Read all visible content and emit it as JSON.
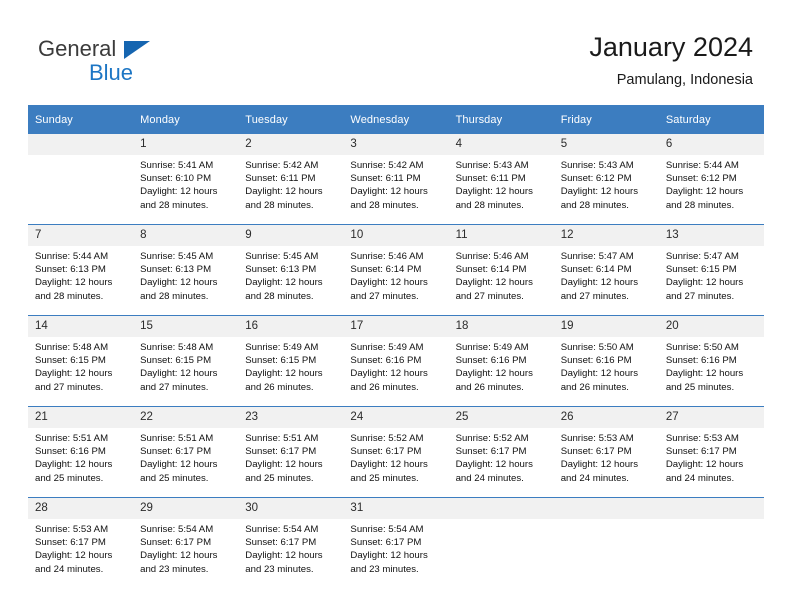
{
  "brand": {
    "name_part1": "General",
    "name_part2": "Blue",
    "triangle_icon": "blue-triangle-icon",
    "color_primary": "#1d76c4",
    "color_text": "#3b3b3b"
  },
  "header": {
    "title": "January 2024",
    "subtitle": "Pamulang, Indonesia"
  },
  "theme": {
    "header_row_bg": "#3c7dc0",
    "daynum_bg": "#f1f1f1",
    "divider": "#3c7dc0"
  },
  "weekdays": [
    "Sunday",
    "Monday",
    "Tuesday",
    "Wednesday",
    "Thursday",
    "Friday",
    "Saturday"
  ],
  "labels": {
    "sunrise_prefix": "Sunrise:",
    "sunset_prefix": "Sunset:",
    "daylight_prefix": "Daylight:"
  },
  "weeks": [
    [
      {
        "day": "",
        "blank": true,
        "l1": "",
        "l2": "",
        "l3": "",
        "l4": ""
      },
      {
        "day": "1",
        "l1": "Sunrise: 5:41 AM",
        "l2": "Sunset: 6:10 PM",
        "l3": "Daylight: 12 hours",
        "l4": "and 28 minutes."
      },
      {
        "day": "2",
        "l1": "Sunrise: 5:42 AM",
        "l2": "Sunset: 6:11 PM",
        "l3": "Daylight: 12 hours",
        "l4": "and 28 minutes."
      },
      {
        "day": "3",
        "l1": "Sunrise: 5:42 AM",
        "l2": "Sunset: 6:11 PM",
        "l3": "Daylight: 12 hours",
        "l4": "and 28 minutes."
      },
      {
        "day": "4",
        "l1": "Sunrise: 5:43 AM",
        "l2": "Sunset: 6:11 PM",
        "l3": "Daylight: 12 hours",
        "l4": "and 28 minutes."
      },
      {
        "day": "5",
        "l1": "Sunrise: 5:43 AM",
        "l2": "Sunset: 6:12 PM",
        "l3": "Daylight: 12 hours",
        "l4": "and 28 minutes."
      },
      {
        "day": "6",
        "l1": "Sunrise: 5:44 AM",
        "l2": "Sunset: 6:12 PM",
        "l3": "Daylight: 12 hours",
        "l4": "and 28 minutes."
      }
    ],
    [
      {
        "day": "7",
        "l1": "Sunrise: 5:44 AM",
        "l2": "Sunset: 6:13 PM",
        "l3": "Daylight: 12 hours",
        "l4": "and 28 minutes."
      },
      {
        "day": "8",
        "l1": "Sunrise: 5:45 AM",
        "l2": "Sunset: 6:13 PM",
        "l3": "Daylight: 12 hours",
        "l4": "and 28 minutes."
      },
      {
        "day": "9",
        "l1": "Sunrise: 5:45 AM",
        "l2": "Sunset: 6:13 PM",
        "l3": "Daylight: 12 hours",
        "l4": "and 28 minutes."
      },
      {
        "day": "10",
        "l1": "Sunrise: 5:46 AM",
        "l2": "Sunset: 6:14 PM",
        "l3": "Daylight: 12 hours",
        "l4": "and 27 minutes."
      },
      {
        "day": "11",
        "l1": "Sunrise: 5:46 AM",
        "l2": "Sunset: 6:14 PM",
        "l3": "Daylight: 12 hours",
        "l4": "and 27 minutes."
      },
      {
        "day": "12",
        "l1": "Sunrise: 5:47 AM",
        "l2": "Sunset: 6:14 PM",
        "l3": "Daylight: 12 hours",
        "l4": "and 27 minutes."
      },
      {
        "day": "13",
        "l1": "Sunrise: 5:47 AM",
        "l2": "Sunset: 6:15 PM",
        "l3": "Daylight: 12 hours",
        "l4": "and 27 minutes."
      }
    ],
    [
      {
        "day": "14",
        "l1": "Sunrise: 5:48 AM",
        "l2": "Sunset: 6:15 PM",
        "l3": "Daylight: 12 hours",
        "l4": "and 27 minutes."
      },
      {
        "day": "15",
        "l1": "Sunrise: 5:48 AM",
        "l2": "Sunset: 6:15 PM",
        "l3": "Daylight: 12 hours",
        "l4": "and 27 minutes."
      },
      {
        "day": "16",
        "l1": "Sunrise: 5:49 AM",
        "l2": "Sunset: 6:15 PM",
        "l3": "Daylight: 12 hours",
        "l4": "and 26 minutes."
      },
      {
        "day": "17",
        "l1": "Sunrise: 5:49 AM",
        "l2": "Sunset: 6:16 PM",
        "l3": "Daylight: 12 hours",
        "l4": "and 26 minutes."
      },
      {
        "day": "18",
        "l1": "Sunrise: 5:49 AM",
        "l2": "Sunset: 6:16 PM",
        "l3": "Daylight: 12 hours",
        "l4": "and 26 minutes."
      },
      {
        "day": "19",
        "l1": "Sunrise: 5:50 AM",
        "l2": "Sunset: 6:16 PM",
        "l3": "Daylight: 12 hours",
        "l4": "and 26 minutes."
      },
      {
        "day": "20",
        "l1": "Sunrise: 5:50 AM",
        "l2": "Sunset: 6:16 PM",
        "l3": "Daylight: 12 hours",
        "l4": "and 25 minutes."
      }
    ],
    [
      {
        "day": "21",
        "l1": "Sunrise: 5:51 AM",
        "l2": "Sunset: 6:16 PM",
        "l3": "Daylight: 12 hours",
        "l4": "and 25 minutes."
      },
      {
        "day": "22",
        "l1": "Sunrise: 5:51 AM",
        "l2": "Sunset: 6:17 PM",
        "l3": "Daylight: 12 hours",
        "l4": "and 25 minutes."
      },
      {
        "day": "23",
        "l1": "Sunrise: 5:51 AM",
        "l2": "Sunset: 6:17 PM",
        "l3": "Daylight: 12 hours",
        "l4": "and 25 minutes."
      },
      {
        "day": "24",
        "l1": "Sunrise: 5:52 AM",
        "l2": "Sunset: 6:17 PM",
        "l3": "Daylight: 12 hours",
        "l4": "and 25 minutes."
      },
      {
        "day": "25",
        "l1": "Sunrise: 5:52 AM",
        "l2": "Sunset: 6:17 PM",
        "l3": "Daylight: 12 hours",
        "l4": "and 24 minutes."
      },
      {
        "day": "26",
        "l1": "Sunrise: 5:53 AM",
        "l2": "Sunset: 6:17 PM",
        "l3": "Daylight: 12 hours",
        "l4": "and 24 minutes."
      },
      {
        "day": "27",
        "l1": "Sunrise: 5:53 AM",
        "l2": "Sunset: 6:17 PM",
        "l3": "Daylight: 12 hours",
        "l4": "and 24 minutes."
      }
    ],
    [
      {
        "day": "28",
        "l1": "Sunrise: 5:53 AM",
        "l2": "Sunset: 6:17 PM",
        "l3": "Daylight: 12 hours",
        "l4": "and 24 minutes."
      },
      {
        "day": "29",
        "l1": "Sunrise: 5:54 AM",
        "l2": "Sunset: 6:17 PM",
        "l3": "Daylight: 12 hours",
        "l4": "and 23 minutes."
      },
      {
        "day": "30",
        "l1": "Sunrise: 5:54 AM",
        "l2": "Sunset: 6:17 PM",
        "l3": "Daylight: 12 hours",
        "l4": "and 23 minutes."
      },
      {
        "day": "31",
        "l1": "Sunrise: 5:54 AM",
        "l2": "Sunset: 6:17 PM",
        "l3": "Daylight: 12 hours",
        "l4": "and 23 minutes."
      },
      {
        "day": "",
        "blank": true,
        "l1": "",
        "l2": "",
        "l3": "",
        "l4": ""
      },
      {
        "day": "",
        "blank": true,
        "l1": "",
        "l2": "",
        "l3": "",
        "l4": ""
      },
      {
        "day": "",
        "blank": true,
        "l1": "",
        "l2": "",
        "l3": "",
        "l4": ""
      }
    ]
  ]
}
